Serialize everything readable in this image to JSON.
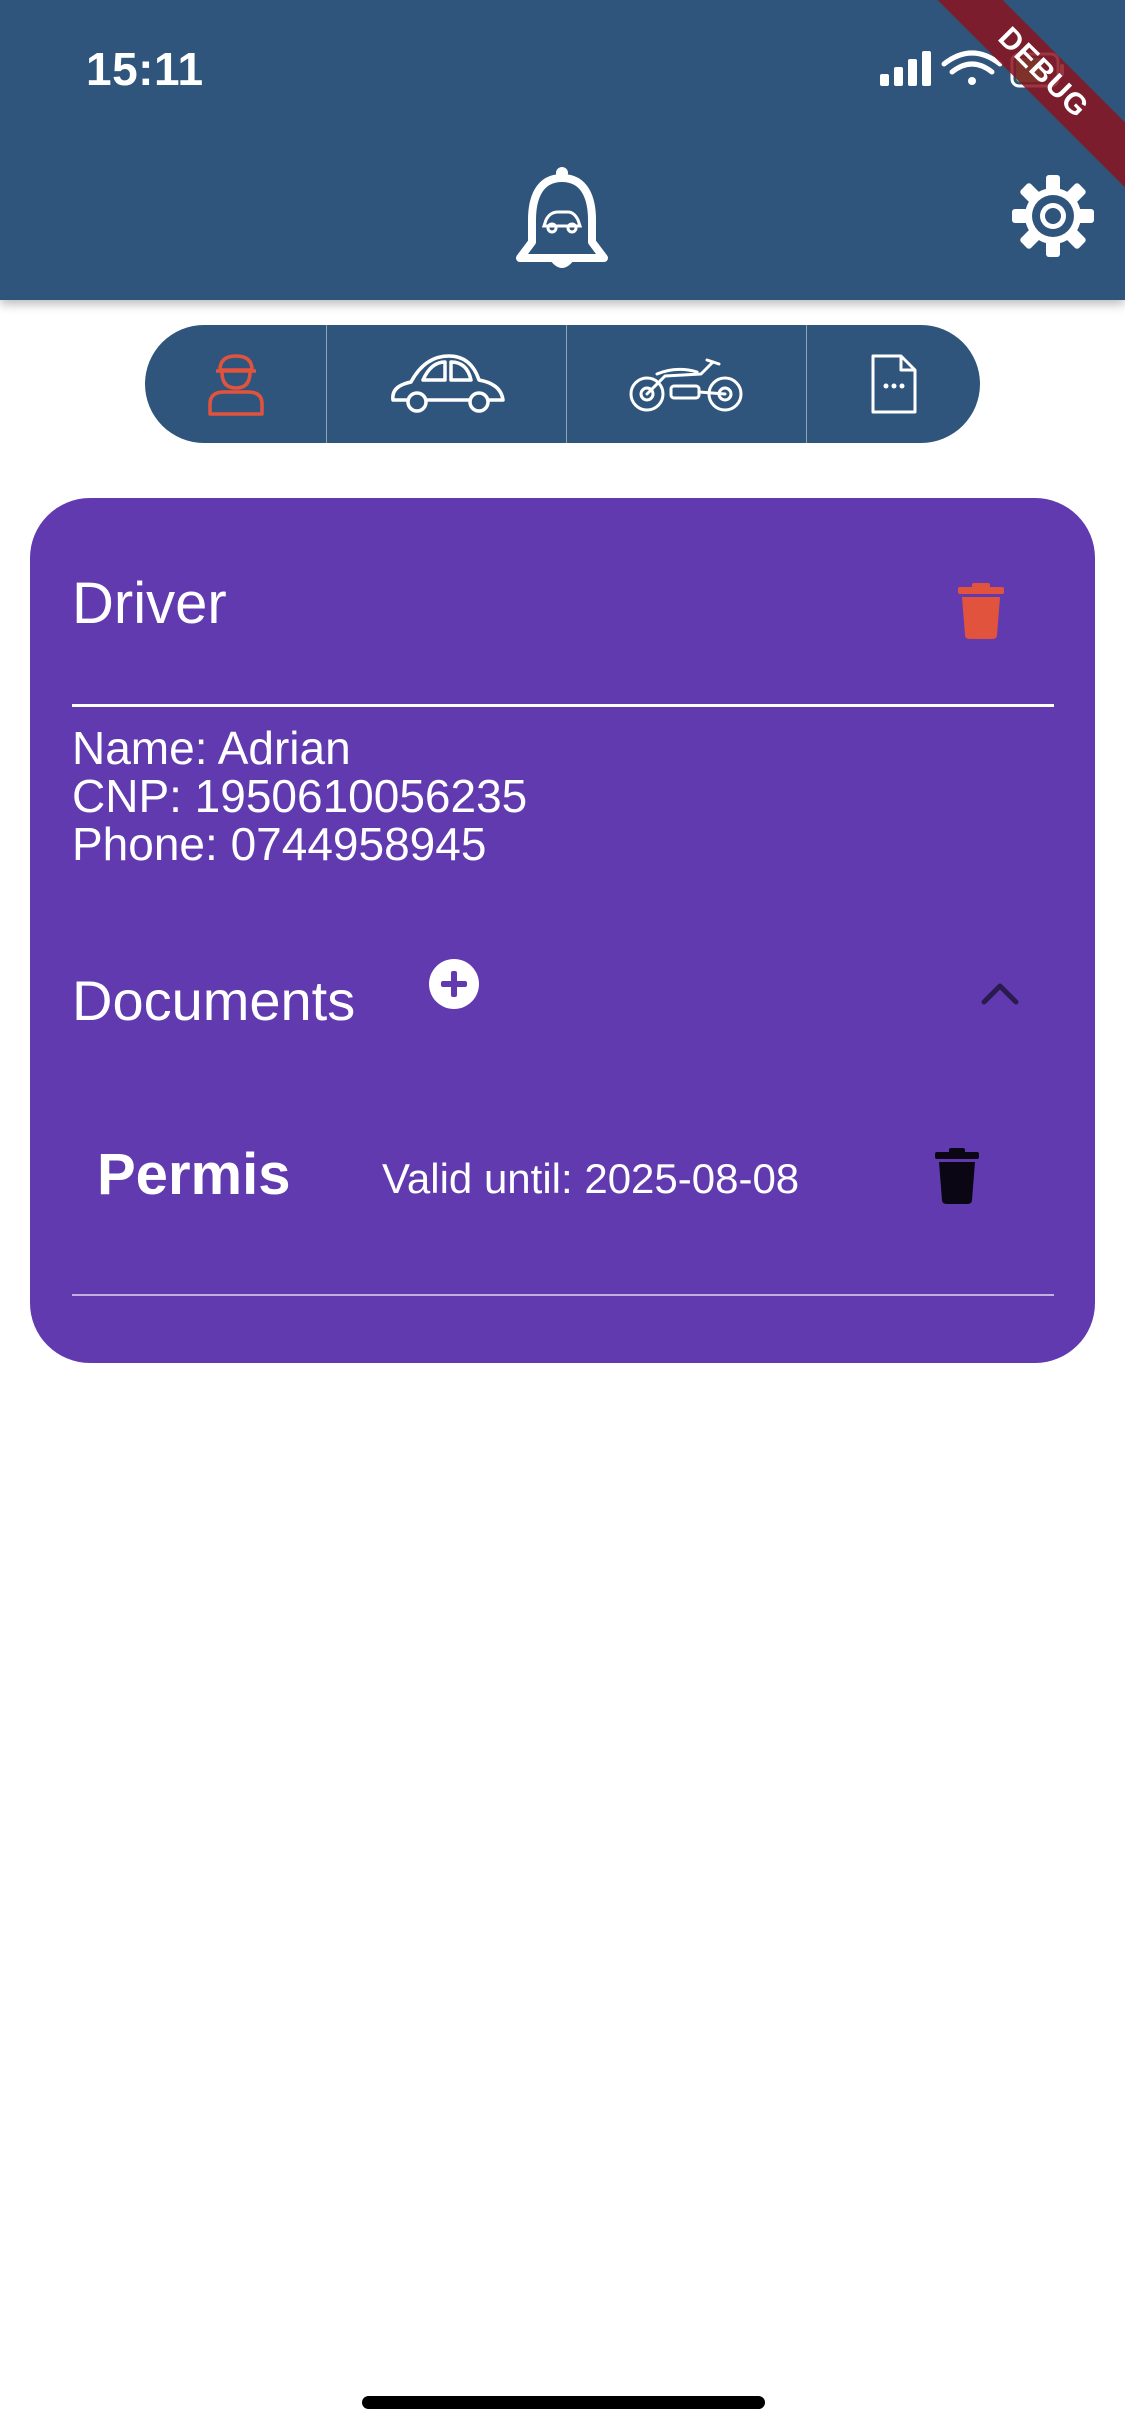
{
  "status_bar": {
    "time": "15:11"
  },
  "debug_banner": "DEBUG",
  "header": {
    "center_icon": "bell-car-icon",
    "right_icon": "gear-icon"
  },
  "tabs": [
    {
      "icon": "driver-icon",
      "selected": true
    },
    {
      "icon": "car-icon",
      "selected": false
    },
    {
      "icon": "motorcycle-icon",
      "selected": false
    },
    {
      "icon": "document-icon",
      "selected": false
    }
  ],
  "card": {
    "title": "Driver",
    "info_lines": [
      "Name: Adrian",
      "CNP: 1950610056235",
      "Phone: 0744958945"
    ],
    "documents_title": "Documents",
    "documents": [
      {
        "name": "Permis",
        "valid_until": "Valid until: 2025-08-08"
      }
    ]
  },
  "colors": {
    "header": "#30557d",
    "card": "#613ab0",
    "accent_red": "#e2533e",
    "white": "#ffffff"
  }
}
